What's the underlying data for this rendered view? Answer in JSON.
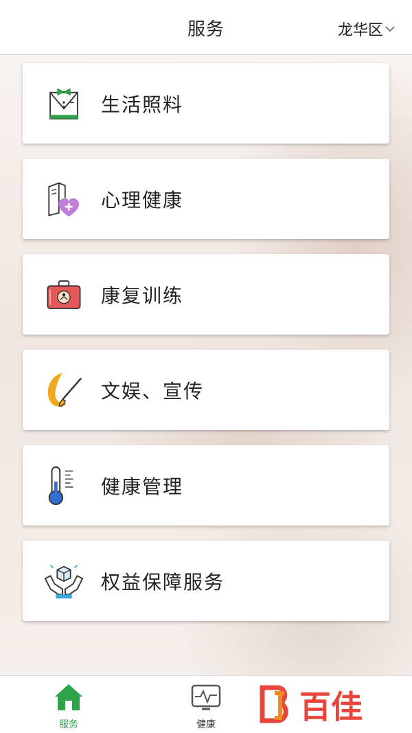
{
  "header": {
    "title": "服务",
    "region": "龙华区"
  },
  "services": [
    {
      "label": "生活照料",
      "icon": "butler-icon"
    },
    {
      "label": "心理健康",
      "icon": "heart-plus-icon"
    },
    {
      "label": "康复训练",
      "icon": "medical-kit-icon"
    },
    {
      "label": "文娱、宣传",
      "icon": "paintbrush-icon"
    },
    {
      "label": "健康管理",
      "icon": "thermometer-icon"
    },
    {
      "label": "权益保障服务",
      "icon": "hands-cube-icon"
    }
  ],
  "tabbar": {
    "tabs": [
      {
        "label": "服务",
        "icon": "home-icon",
        "active": true
      },
      {
        "label": "健康",
        "icon": "monitor-pulse-icon",
        "active": false
      }
    ]
  },
  "watermark": "百佳",
  "colors": {
    "active_tab": "#2ca54a",
    "inactive_tab": "#333333",
    "watermark_red": "#e8453c"
  }
}
